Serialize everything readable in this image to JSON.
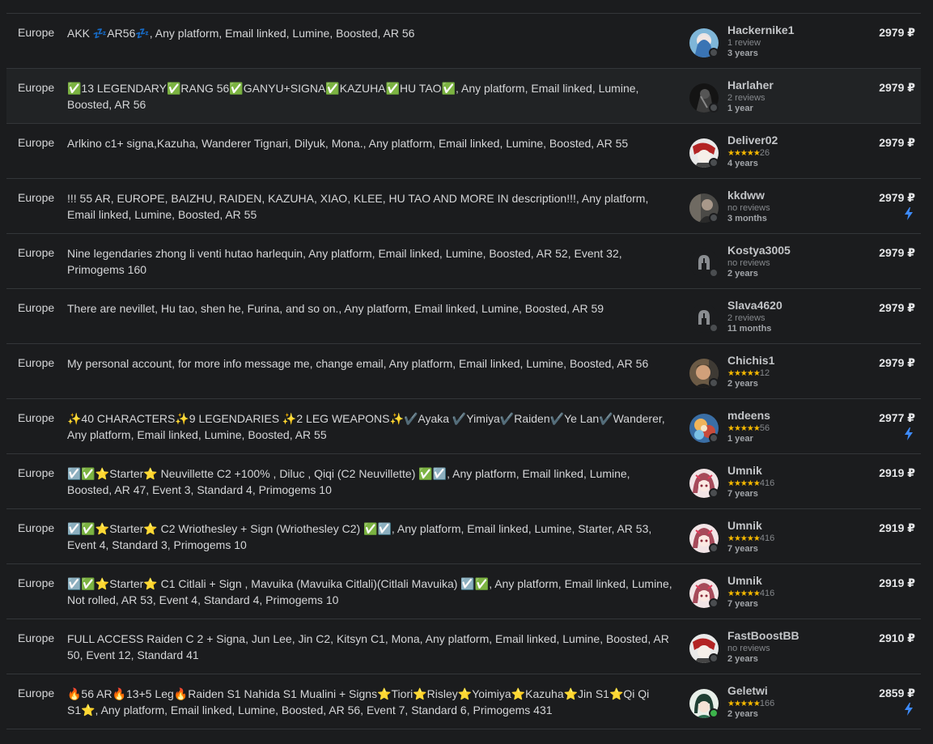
{
  "currency": "₽",
  "colors": {
    "background": "#1b1c1e",
    "divider": "#333639",
    "star": "#f5b800",
    "bolt": "#3d8bfd",
    "online": "#3cb44b"
  },
  "offers": [
    {
      "server": "Europe",
      "description": "AKK 💤AR56💤, Any platform, Email linked, Lumine, Boosted, AR 56",
      "seller": "Hackernike1",
      "rating_text": "1 review",
      "stars": "",
      "age": "3 years",
      "price": "2979 ₽",
      "instant": false,
      "online": false,
      "avatar": "anime-blue"
    },
    {
      "server": "Europe",
      "description": "✅13 LEGENDARY✅RANG 56✅GANYU+SIGNA✅KAZUHA✅HU TAO✅, Any platform, Email linked, Lumine, Boosted, AR 56",
      "seller": "Harlaher",
      "rating_text": "2 reviews",
      "stars": "",
      "age": "1 year",
      "price": "2979 ₽",
      "instant": false,
      "online": false,
      "avatar": "dark-figure"
    },
    {
      "server": "Europe",
      "description": "Arlkino c1+ signa,Kazuha, Wanderer Tignari, Dilyuk, Mona., Any platform, Email linked, Lumine, Boosted, AR 55",
      "seller": "Deliver02",
      "rating_text": "26",
      "stars": "★★★★★",
      "age": "4 years",
      "price": "2979 ₽",
      "instant": false,
      "online": false,
      "avatar": "red-white"
    },
    {
      "server": "Europe",
      "description": "!!! 55 AR, EUROPE, BAIZHU, RAIDEN, KAZUHA, XIAO, KLEE, HU TAO AND MORE IN description!!!, Any platform, Email linked, Lumine, Boosted, AR 55",
      "seller": "kkdww",
      "rating_text": "no reviews",
      "stars": "",
      "age": "3 months",
      "price": "2979 ₽",
      "instant": true,
      "online": false,
      "avatar": "photo-dark"
    },
    {
      "server": "Europe",
      "description": "Nine legendaries zhong li venti hutao harlequin, Any platform, Email linked, Lumine, Boosted, AR 52, Event 32, Primogems 160",
      "seller": "Kostya3005",
      "rating_text": "no reviews",
      "stars": "",
      "age": "2 years",
      "price": "2979 ₽",
      "instant": false,
      "online": false,
      "avatar": "default-helmet"
    },
    {
      "server": "Europe",
      "description": "There are nevillet, Hu tao, shen he, Furina, and so on., Any platform, Email linked, Lumine, Boosted, AR 59",
      "seller": "Slava4620",
      "rating_text": "2 reviews",
      "stars": "",
      "age": "11 months",
      "price": "2979 ₽",
      "instant": false,
      "online": false,
      "avatar": "default-helmet"
    },
    {
      "server": "Europe",
      "description": "My personal account, for more info message me, change email, Any platform, Email linked, Lumine, Boosted, AR 56",
      "seller": "Chichis1",
      "rating_text": "12",
      "stars": "★★★★★",
      "age": "2 years",
      "price": "2979 ₽",
      "instant": false,
      "online": false,
      "avatar": "photo-face"
    },
    {
      "server": "Europe",
      "description": "✨40 CHARACTERS✨9 LEGENDARIES ✨2 LEG WEAPONS✨✔️Ayaka ✔️Yimiya✔️Raiden✔️Ye Lan✔️Wanderer, Any platform, Email linked, Lumine, Boosted, AR 55",
      "seller": "mdeens",
      "rating_text": "56",
      "stars": "★★★★★",
      "age": "1 year",
      "price": "2977 ₽",
      "instant": true,
      "online": false,
      "avatar": "anime-colorful"
    },
    {
      "server": "Europe",
      "description": "☑️✅⭐Starter⭐ Neuvillette C2 +100% , Diluc , Qiqi (C2 Neuvillette) ✅☑️, Any platform, Email linked, Lumine, Boosted, AR 47, Event 3, Standard 4, Primogems 10",
      "seller": "Umnik",
      "rating_text": "416",
      "stars": "★★★★★",
      "age": "7 years",
      "price": "2919 ₽",
      "instant": false,
      "online": false,
      "avatar": "anime-pink"
    },
    {
      "server": "Europe",
      "description": "☑️✅⭐Starter⭐ C2 Wriothesley + Sign (Wriothesley C2) ✅☑️, Any platform, Email linked, Lumine, Starter, AR 53, Event 4, Standard 3, Primogems 10",
      "seller": "Umnik",
      "rating_text": "416",
      "stars": "★★★★★",
      "age": "7 years",
      "price": "2919 ₽",
      "instant": false,
      "online": false,
      "avatar": "anime-pink"
    },
    {
      "server": "Europe",
      "description": "☑️✅⭐Starter⭐ C1 Citlali + Sign , Mavuika (Mavuika Citlali)(Citlali Mavuika) ☑️✅, Any platform, Email linked, Lumine, Not rolled, AR 53, Event 4, Standard 4, Primogems 10",
      "seller": "Umnik",
      "rating_text": "416",
      "stars": "★★★★★",
      "age": "7 years",
      "price": "2919 ₽",
      "instant": false,
      "online": false,
      "avatar": "anime-pink"
    },
    {
      "server": "Europe",
      "description": "FULL ACCESS Raiden C 2 + Signa, Jun Lee, Jin C2, Kitsyn C1, Mona, Any platform, Email linked, Lumine, Boosted, AR 50, Event 12, Standard 41",
      "seller": "FastBoostBB",
      "rating_text": "no reviews",
      "stars": "",
      "age": "2 years",
      "price": "2910 ₽",
      "instant": false,
      "online": false,
      "avatar": "red-white"
    },
    {
      "server": "Europe",
      "description": "🔥56 AR🔥13+5 Leg🔥Raiden S1 Nahida S1 Mualini + Signs⭐Tiori⭐Risley⭐Yoimiya⭐Kazuha⭐Jin S1⭐Qi Qi S1⭐, Any platform, Email linked, Lumine, Boosted, AR 56, Event 7, Standard 6, Primogems 431",
      "seller": "Geletwi",
      "rating_text": "166",
      "stars": "★★★★★",
      "age": "2 years",
      "price": "2859 ₽",
      "instant": true,
      "online": true,
      "avatar": "anime-green"
    }
  ]
}
